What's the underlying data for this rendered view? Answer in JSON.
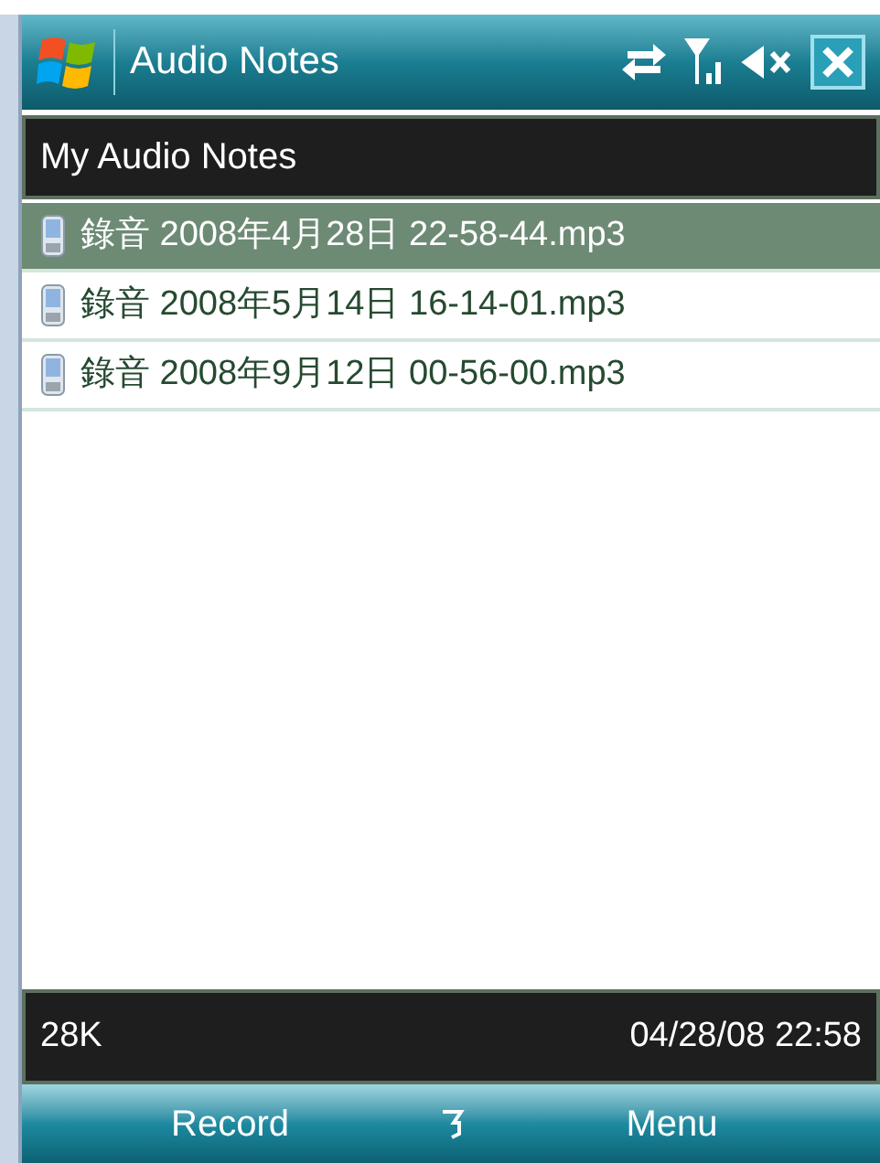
{
  "title_bar": {
    "title": "Audio Notes"
  },
  "header": {
    "title": "My Audio Notes"
  },
  "files": [
    {
      "name": "錄音 2008年4月28日 22-58-44.mp3",
      "selected": true
    },
    {
      "name": "錄音 2008年5月14日 16-14-01.mp3",
      "selected": false
    },
    {
      "name": "錄音 2008年9月12日 00-56-00.mp3",
      "selected": false
    }
  ],
  "status_bar": {
    "size": "28K",
    "date": "04/28/08 22:58"
  },
  "soft_keys": {
    "left": "Record",
    "right": "Menu"
  }
}
